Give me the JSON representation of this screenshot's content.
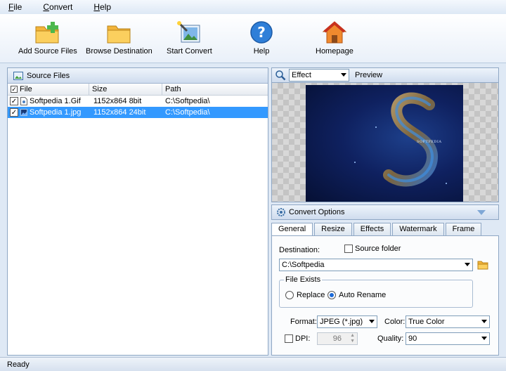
{
  "menu": {
    "items": [
      "File",
      "Convert",
      "Help"
    ]
  },
  "toolbar": {
    "add_source": "Add Source Files",
    "browse_dest": "Browse Destination",
    "start_convert": "Start Convert",
    "help": "Help",
    "homepage": "Homepage"
  },
  "source_panel": {
    "title": "Source Files",
    "columns": [
      "File",
      "Size",
      "Path"
    ],
    "rows": [
      {
        "name": "Softpedia 1.Gif",
        "size": "1152x864 8bit",
        "path": "C:\\Softpedia\\",
        "checked": true,
        "selected": false
      },
      {
        "name": "Softpedia 1.jpg",
        "size": "1152x864 24bit",
        "path": "C:\\Softpedia\\",
        "checked": true,
        "selected": true
      }
    ]
  },
  "preview": {
    "effect_value": "Effect",
    "label": "Preview",
    "image_text": "SOFTPEDIA"
  },
  "options": {
    "title": "Convert Options",
    "tabs": [
      "General",
      "Resize",
      "Effects",
      "Watermark",
      "Frame"
    ],
    "destination_label": "Destination:",
    "source_folder_label": "Source folder",
    "destination_value": "C:\\Softpedia",
    "file_exists_label": "File Exists",
    "replace_label": "Replace",
    "auto_rename_label": "Auto Rename",
    "format_label": "Format:",
    "format_value": "JPEG (*.jpg)",
    "color_label": "Color:",
    "color_value": "True Color",
    "dpi_label": "DPI:",
    "dpi_value": "96",
    "quality_label": "Quality:",
    "quality_value": "90"
  },
  "status": {
    "text": "Ready"
  },
  "colors": {
    "accent": "#3399ff",
    "header": "#cfdcee"
  }
}
